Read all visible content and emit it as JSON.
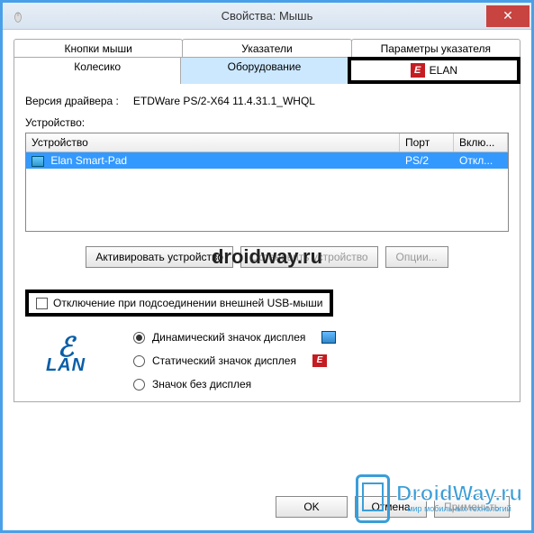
{
  "window": {
    "title": "Свойства: Мышь",
    "close": "✕"
  },
  "tabs": {
    "row1": [
      "Кнопки мыши",
      "Указатели",
      "Параметры указателя"
    ],
    "row2": [
      "Колесико",
      "Оборудование"
    ],
    "elan": "ELAN"
  },
  "driver": {
    "label": "Версия драйвера :",
    "value": "ETDWare PS/2-X64 11.4.31.1_WHQL"
  },
  "deviceSection": {
    "title": "Устройство:"
  },
  "listview": {
    "headers": {
      "device": "Устройство",
      "port": "Порт",
      "enabled": "Вклю..."
    },
    "row": {
      "name": "Elan Smart-Pad",
      "port": "PS/2",
      "enabled": "Откл..."
    }
  },
  "buttons": {
    "activate": "Активировать устройство",
    "stop": "Остановить устройство",
    "options": "Опции..."
  },
  "overlay": "droidway.ru",
  "checkbox": {
    "label": "Отключение при подсоединении внешней USB-мыши"
  },
  "radios": {
    "dynamic": "Динамический значок дисплея",
    "static": "Статический значок дисплея",
    "none": "Значок без дисплея"
  },
  "dialog": {
    "ok": "OK",
    "cancel": "Отмена",
    "apply": "Применить"
  },
  "watermark": {
    "main": "DroidWay.ru",
    "sub": "мир мобильных технологий"
  },
  "elanIconText": "E"
}
